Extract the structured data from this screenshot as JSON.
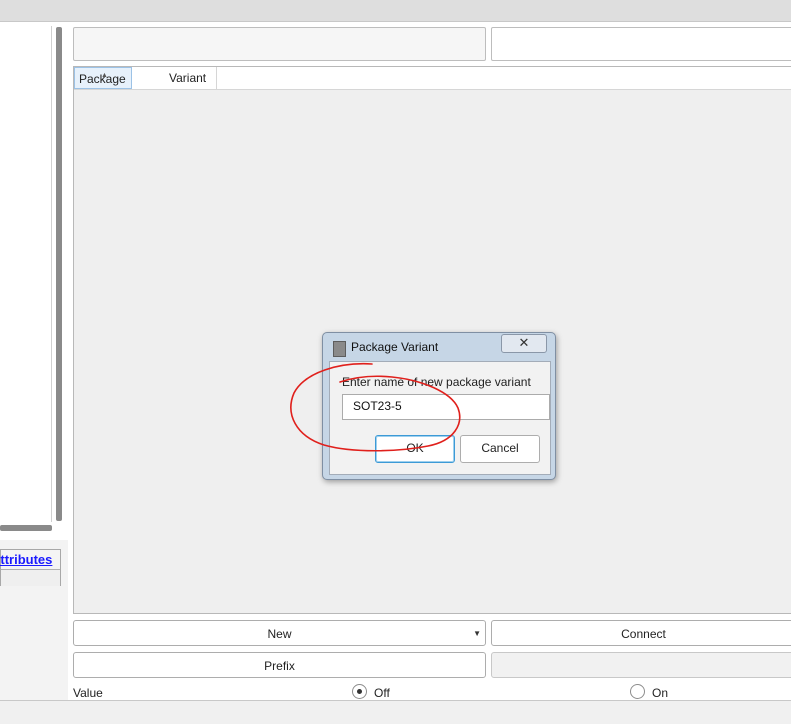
{
  "list": {
    "columns": [
      "Package",
      "Variant"
    ]
  },
  "left_panel": {
    "attributes_link": "Attributes"
  },
  "buttons": {
    "new": "New",
    "connect": "Connect",
    "prefix": "Prefix"
  },
  "value_row": {
    "label": "Value",
    "options": [
      {
        "label": "Off",
        "selected": true
      },
      {
        "label": "On",
        "selected": false
      }
    ]
  },
  "dialog": {
    "title": "Package Variant",
    "close_glyph": "✕",
    "prompt": "Enter name of new package variant",
    "input_value": "SOT23-5",
    "ok": "OK",
    "cancel": "Cancel"
  },
  "colors": {
    "annotation": "#e0201c",
    "link": "#1a1aff",
    "focus": "#3c9ad6"
  },
  "icons": [
    "package-variant-icon",
    "close-icon",
    "dropdown-arrow-icon",
    "sort-caret-icon"
  ]
}
